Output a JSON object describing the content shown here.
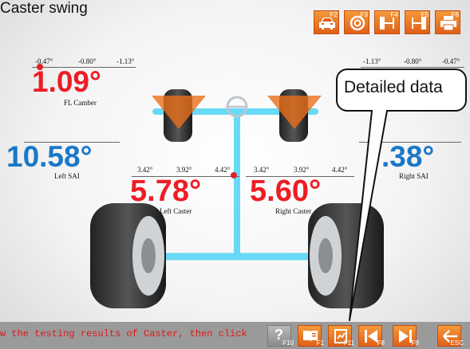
{
  "title": "Caster swing",
  "toolbar": [
    {
      "icon": "car-icon",
      "key": "F2"
    },
    {
      "icon": "wheel-icon",
      "key": "F3"
    },
    {
      "icon": "wheel-left-icon",
      "key": "F4"
    },
    {
      "icon": "wheel-right-icon",
      "key": "F5"
    },
    {
      "icon": "printer-icon",
      "key": "F6"
    }
  ],
  "fl_camber": {
    "ticks": [
      "-0.47°",
      "-0.80°",
      "-1.13°"
    ],
    "value": "1.09°",
    "label": "FL Camber"
  },
  "fr_camber": {
    "ticks": [
      "-1.13°",
      "-0.80°",
      "-0.47°"
    ]
  },
  "left_sai": {
    "value": "10.58°",
    "label": "Left SAI"
  },
  "right_sai": {
    "value": ".38°",
    "label": "Right SAI"
  },
  "left_caster": {
    "ticks": [
      "3.42°",
      "3.92°",
      "4.42°"
    ],
    "value": "5.78°",
    "label": "Left Caster"
  },
  "right_caster": {
    "ticks": [
      "3.42°",
      "3.92°",
      "4.42°"
    ],
    "value": "5.60°",
    "label": "Right Caster"
  },
  "callout": "Detailed data",
  "status": "w the testing results of Caster, then click",
  "bottom_buttons": [
    {
      "icon": "help-icon",
      "key": "F10",
      "glyph": "?"
    },
    {
      "icon": "book-icon",
      "key": "F1"
    },
    {
      "icon": "report-icon",
      "key": "F11"
    },
    {
      "icon": "first-page-icon",
      "key": "F8"
    },
    {
      "icon": "last-page-icon",
      "key": "F9"
    },
    {
      "icon": "back-arrow-icon",
      "key": "ESC"
    }
  ],
  "colors": {
    "accent": "#e8711c",
    "value_red": "#ee1c25",
    "value_blue": "#1a78c8",
    "axle": "#4fd4f5"
  }
}
